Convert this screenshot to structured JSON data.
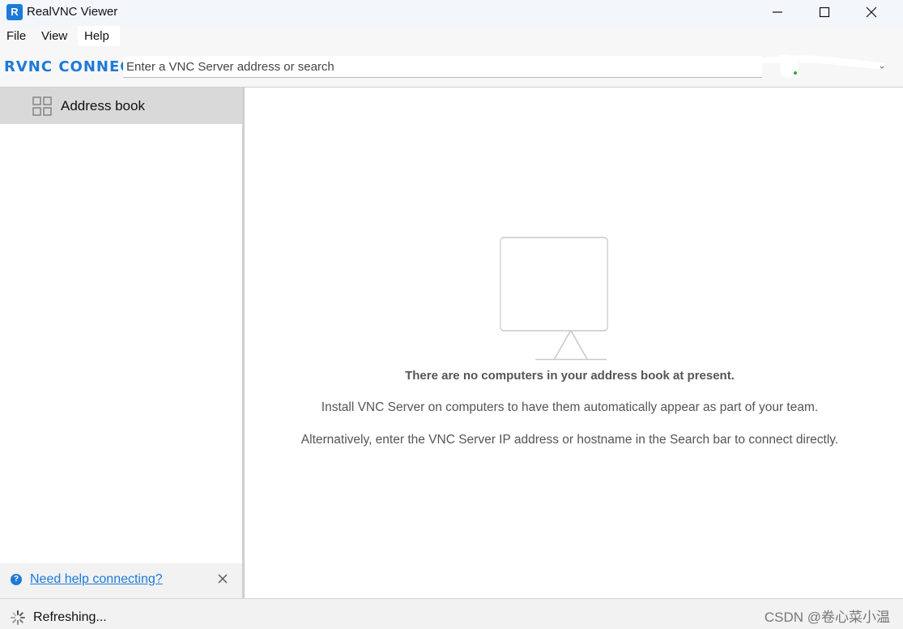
{
  "window": {
    "title": "RealVNC Viewer",
    "icon": "realvnc-app-icon"
  },
  "menu": {
    "items": [
      "File",
      "View",
      "Help"
    ]
  },
  "toolbar": {
    "logo_text": "RVNC CONNECT",
    "search_placeholder": "Enter a VNC Server address or search"
  },
  "sidebar": {
    "items": [
      {
        "label": "Address book",
        "icon": "grid-icon",
        "selected": true
      }
    ],
    "help_link": "Need help connecting?"
  },
  "main": {
    "empty_title": "There are no computers in your address book at present.",
    "line1": "Install VNC Server on computers to have them automatically appear as part of your team.",
    "line2": "Alternatively, enter the VNC Server IP address or hostname in the Search bar to connect directly."
  },
  "status": {
    "text": "Refreshing..."
  },
  "watermark": "CSDN @卷心菜小温",
  "colors": {
    "accent": "#1e7ad7",
    "selected_bg": "#d9d9d9"
  }
}
